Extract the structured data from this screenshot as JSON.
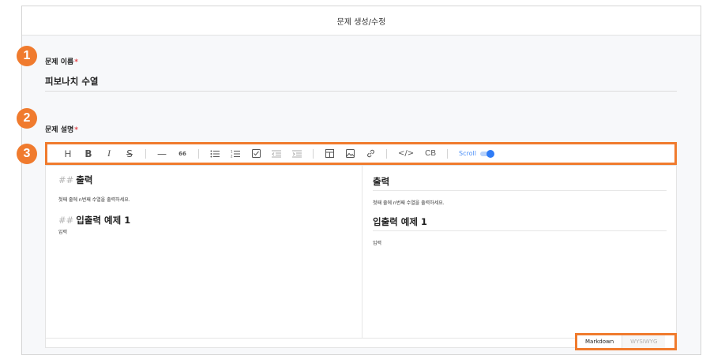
{
  "header": {
    "title": "문제 생성/수정"
  },
  "markers": [
    "1",
    "2",
    "3"
  ],
  "fields": {
    "title_label": "문제 이름",
    "title_value": "피보나치 수열",
    "desc_label": "문제 설명",
    "required_mark": "*"
  },
  "toolbar": {
    "heading": "H",
    "bold": "B",
    "italic": "I",
    "strike": "S",
    "hr": "—",
    "quote": "66",
    "code": "</>",
    "codeblock": "CB",
    "scroll_label": "Scroll",
    "scroll_sync": true
  },
  "editor": {
    "hash": "##",
    "heading1": "출력",
    "line1": "첫째 줄에 n번째 수열을 출력하세요.",
    "heading2": "입출력 예제 1",
    "line2": "입력"
  },
  "preview": {
    "heading1": "출력",
    "line1": "첫째 줄에 n번째 수열을 출력하세요.",
    "heading2": "입출력 예제 1",
    "line2": "입력"
  },
  "modes": {
    "markdown": "Markdown",
    "wysiwyg": "WYSIWYG",
    "selected": "Markdown"
  },
  "colors": {
    "accent": "#f07b2e",
    "toggle": "#2f7cf6",
    "required": "#e5484d"
  }
}
